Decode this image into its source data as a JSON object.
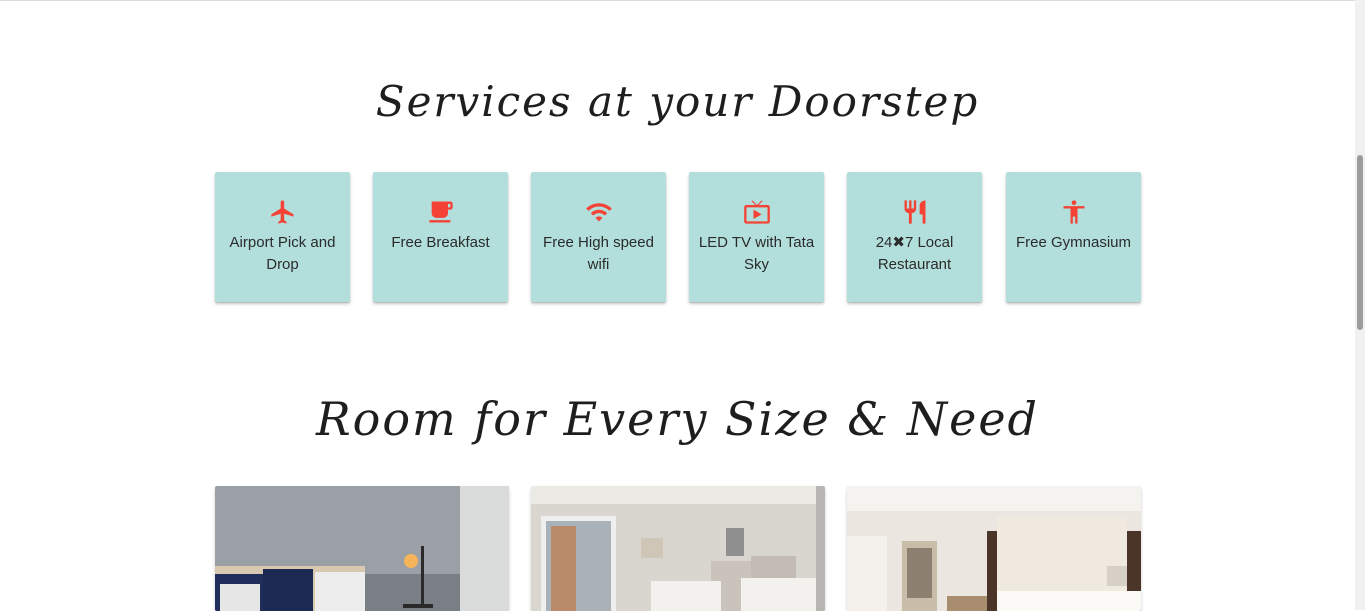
{
  "services_section": {
    "title": "Services at your Doorstep",
    "items": [
      {
        "icon": "airplane-icon",
        "label": "Airport Pick and Drop"
      },
      {
        "icon": "coffee-cup-icon",
        "label": "Free Breakfast"
      },
      {
        "icon": "wifi-icon",
        "label": "Free High speed wifi"
      },
      {
        "icon": "tv-icon",
        "label": "LED TV with Tata Sky"
      },
      {
        "icon": "restaurant-icon",
        "label": "24✖7 Local Restaurant"
      },
      {
        "icon": "gymnasium-icon",
        "label": "Free Gymnasium"
      }
    ]
  },
  "rooms_section": {
    "title": "Room for Every Size & Need",
    "rooms": [
      {
        "image": "bedroom-lamp-photo"
      },
      {
        "image": "twin-bed-room-photo"
      },
      {
        "image": "luxury-bedroom-photo"
      }
    ]
  },
  "colors": {
    "card_background": "#b2dfdb",
    "icon_accent": "#f44336",
    "heading_text": "#1e1e1e"
  }
}
